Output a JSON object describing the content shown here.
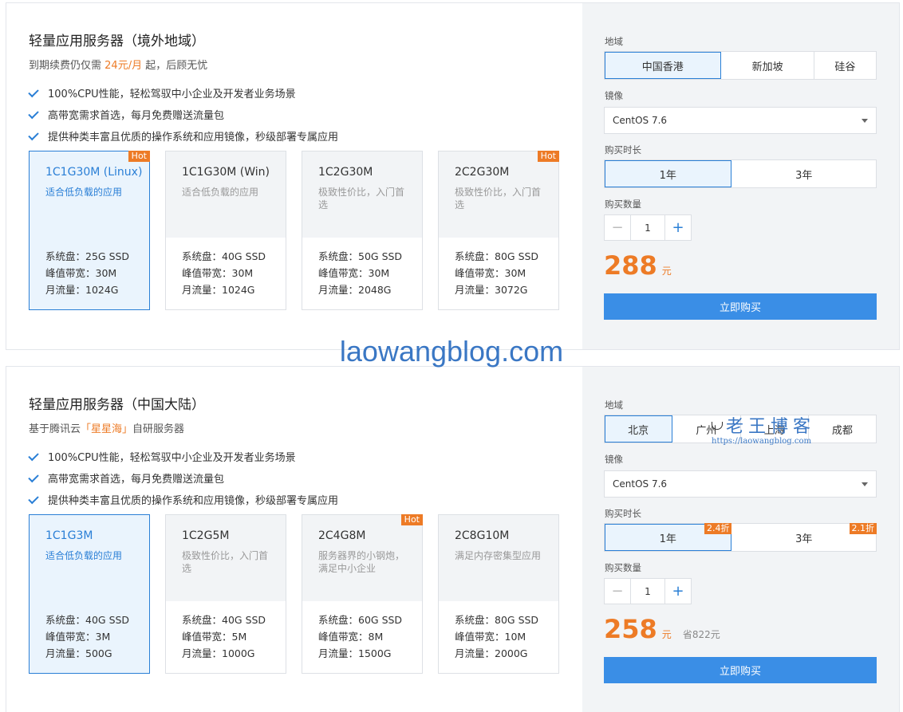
{
  "panel1": {
    "title": "轻量应用服务器（境外地域）",
    "subtitle_prefix": "到期续费仍仅需",
    "subtitle_accent": "24元/月",
    "subtitle_suffix": "起，后顾无忧",
    "features": [
      "100%CPU性能，轻松驾驭中小企业及开发者业务场景",
      "高带宽需求首选，每月免费赠送流量包",
      "提供种类丰富且优质的操作系统和应用镜像，秒级部署专属应用"
    ],
    "cards": [
      {
        "name": "1C1G30M (Linux)",
        "desc": "适合低负载的应用",
        "disk": "系统盘：25G SSD",
        "bandwidth": "峰值带宽：30M",
        "traffic": "月流量：1024G",
        "hot": "Hot"
      },
      {
        "name": "1C1G30M (Win)",
        "desc": "适合低负载的应用",
        "disk": "系统盘：40G SSD",
        "bandwidth": "峰值带宽：30M",
        "traffic": "月流量：1024G"
      },
      {
        "name": "1C2G30M",
        "desc": "极致性价比，入门首选",
        "disk": "系统盘：50G SSD",
        "bandwidth": "峰值带宽：30M",
        "traffic": "月流量：2048G"
      },
      {
        "name": "2C2G30M",
        "desc": "极致性价比，入门首选",
        "disk": "系统盘：80G SSD",
        "bandwidth": "峰值带宽：30M",
        "traffic": "月流量：3072G",
        "hot": "Hot"
      }
    ],
    "region_label": "地域",
    "regions": [
      "中国香港",
      "新加坡",
      "硅谷"
    ],
    "image_label": "镜像",
    "image_value": "CentOS 7.6",
    "duration_label": "购买时长",
    "durations": [
      "1年",
      "3年"
    ],
    "qty_label": "购买数量",
    "qty": "1",
    "price": "288",
    "price_unit": "元",
    "buy_label": "立即购买"
  },
  "panel2": {
    "title": "轻量应用服务器（中国大陆）",
    "subtitle_prefix": "基于腾讯云",
    "subtitle_accent": "「星星海」",
    "subtitle_suffix": "自研服务器",
    "features": [
      "100%CPU性能，轻松驾驭中小企业及开发者业务场景",
      "高带宽需求首选，每月免费赠送流量包",
      "提供种类丰富且优质的操作系统和应用镜像，秒级部署专属应用"
    ],
    "cards": [
      {
        "name": "1C1G3M",
        "desc": "适合低负载的应用",
        "disk": "系统盘：40G SSD",
        "bandwidth": "峰值带宽：3M",
        "traffic": "月流量：500G"
      },
      {
        "name": "1C2G5M",
        "desc": "极致性价比，入门首选",
        "disk": "系统盘：40G SSD",
        "bandwidth": "峰值带宽：5M",
        "traffic": "月流量：1000G"
      },
      {
        "name": "2C4G8M",
        "desc": "服务器界的小钢炮，满足中小企业",
        "disk": "系统盘：60G SSD",
        "bandwidth": "峰值带宽：8M",
        "traffic": "月流量：1500G",
        "hot": "Hot"
      },
      {
        "name": "2C8G10M",
        "desc": "满足内存密集型应用",
        "disk": "系统盘：80G SSD",
        "bandwidth": "峰值带宽：10M",
        "traffic": "月流量：2000G"
      }
    ],
    "region_label": "地域",
    "regions": [
      "北京",
      "广州",
      "上海",
      "成都"
    ],
    "image_label": "镜像",
    "image_value": "CentOS 7.6",
    "duration_label": "购买时长",
    "durations": [
      "1年",
      "3年"
    ],
    "duration_discounts": [
      "2.4折",
      "2.1折"
    ],
    "qty_label": "购买数量",
    "qty": "1",
    "price": "258",
    "price_unit": "元",
    "save": "省822元",
    "buy_label": "立即购买"
  },
  "watermark": {
    "center": "laowangblog.com",
    "logo": "老王博客",
    "logo_url": "https://laowangblog.com"
  },
  "colors": {
    "accent": "#2a7fd6",
    "orange": "#ed7b26",
    "button": "#3a8ee6",
    "panel_gray": "#f2f4f6"
  }
}
